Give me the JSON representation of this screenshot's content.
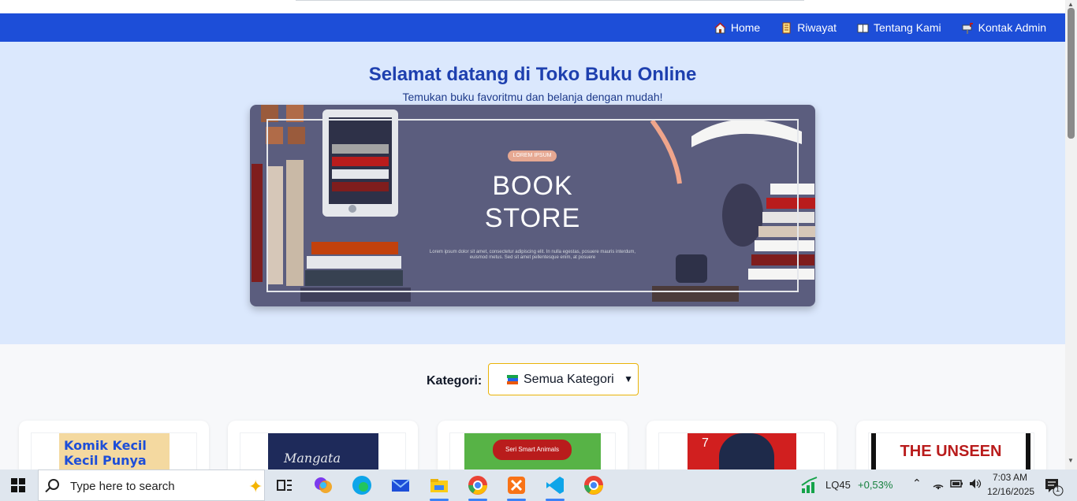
{
  "nav": {
    "items": [
      {
        "label": "Home",
        "icon": "house-icon"
      },
      {
        "label": "Riwayat",
        "icon": "scroll-icon"
      },
      {
        "label": "Tentang Kami",
        "icon": "book-icon"
      },
      {
        "label": "Kontak Admin",
        "icon": "mailbox-icon"
      }
    ]
  },
  "hero": {
    "title": "Selamat datang di Toko Buku Online",
    "subtitle": "Temukan buku favoritmu dan belanja dengan mudah!",
    "banner": {
      "pill": "LOREM IPSUM",
      "line1": "BOOK",
      "line2": "STORE",
      "lorem": "Lorem ipsum dolor sit amet, consectetur adipiscing elit. In nulla egestas, posuere mauris interdum, euismod metus. Sed sit amet pellentesque enim, at posuere"
    }
  },
  "filter": {
    "label": "Kategori:",
    "selected": "Semua Kategori"
  },
  "books": [
    {
      "cover_text": "Komik Kecil Kecil Punya Karya"
    },
    {
      "cover_text": "Mangata"
    },
    {
      "cover_text": "Seri Smart Animals"
    },
    {
      "cover_text": "7"
    },
    {
      "cover_text": "THE UNSEEN"
    }
  ],
  "taskbar": {
    "search_placeholder": "Type here to search",
    "stock_name": "LQ45",
    "stock_change": "+0,53%",
    "time": "7:03 AM",
    "date": "12/16/2025",
    "notification_count": "1"
  },
  "colors": {
    "nav_bg": "#1d4ed8",
    "hero_bg": "#dbe8fd",
    "title": "#1e40af",
    "select_border": "#eab308",
    "stock_up": "#15803d"
  }
}
